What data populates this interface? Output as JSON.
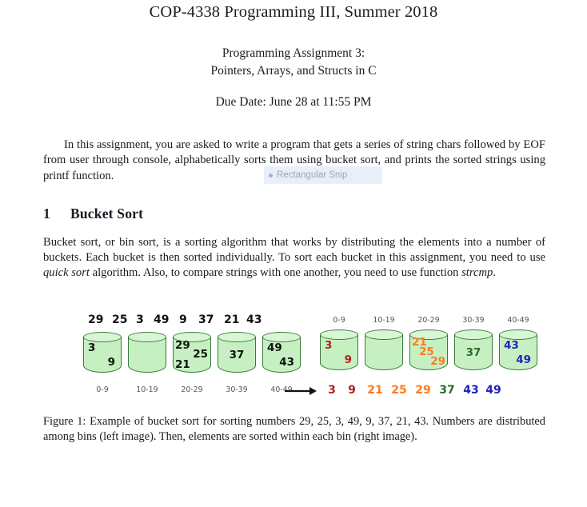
{
  "document": {
    "title": "COP-4338 Programming III, Summer 2018",
    "subtitle_line1": "Programming Assignment 3:",
    "subtitle_line2": "Pointers, Arrays, and Structs in C",
    "due_date": "Due Date: June 28 at 11:55 PM",
    "intro_paragraph": "In this assignment, you are asked to write a program that gets a series of string chars followed by EOF from user through console, alphabetically sorts them using bucket sort, and prints the sorted strings using printf function.",
    "section": {
      "number": "1",
      "heading": "Bucket Sort",
      "paragraph_part1": "Bucket sort, or bin sort, is a sorting algorithm that works by distributing the elements into a number of buckets. Each bucket is then sorted individually. To sort each bucket in this assignment, you need to use ",
      "paragraph_italic1": "quick sort",
      "paragraph_part2": " algorithm. Also, to compare strings with one another, you need to use function ",
      "paragraph_italic2": "strcmp",
      "paragraph_part3": "."
    },
    "caption": "Figure 1: Example of bucket sort for sorting numbers 29, 25, 3, 49, 9, 37, 21, 43. Numbers are distributed among bins (left image). Then, elements are sorted within each bin (right image)."
  },
  "snip_overlay": {
    "label": "Rectangular Snip"
  },
  "figure": {
    "input_sequence": [
      "29",
      "25",
      "3",
      "49",
      "9",
      "37",
      "21",
      "43"
    ],
    "bucket_ranges": [
      "0-9",
      "10-19",
      "20-29",
      "30-39",
      "40-49"
    ],
    "left_buckets": [
      {
        "range": "0-9",
        "items": [
          "3",
          "9"
        ]
      },
      {
        "range": "10-19",
        "items": []
      },
      {
        "range": "20-29",
        "items": [
          "29",
          "25",
          "21"
        ]
      },
      {
        "range": "30-39",
        "items": [
          "37"
        ]
      },
      {
        "range": "40-49",
        "items": [
          "49",
          "43"
        ]
      }
    ],
    "right_buckets": [
      {
        "range": "0-9",
        "items": [
          "3",
          "9"
        ],
        "color": "#b42020"
      },
      {
        "range": "10-19",
        "items": [],
        "color": "#b42020"
      },
      {
        "range": "20-29",
        "items": [
          "21",
          "25",
          "29"
        ],
        "color": "#ff7b20"
      },
      {
        "range": "30-39",
        "items": [
          "37"
        ],
        "color": "#2d6b2d"
      },
      {
        "range": "40-49",
        "items": [
          "43",
          "49"
        ],
        "color": "#2222bb"
      }
    ],
    "sorted_output": [
      {
        "value": "3",
        "color": "#b42020"
      },
      {
        "value": "9",
        "color": "#b42020"
      },
      {
        "value": "21",
        "color": "#ff7b20"
      },
      {
        "value": "25",
        "color": "#ff7b20"
      },
      {
        "value": "29",
        "color": "#ff7b20"
      },
      {
        "value": "37",
        "color": "#2d6b2d"
      },
      {
        "value": "43",
        "color": "#2222bb"
      },
      {
        "value": "49",
        "color": "#2222bb"
      }
    ],
    "bucket_fill_color": "#c6f0c2",
    "bucket_stroke_color": "#3c7a3c",
    "arrow_direction": "right"
  }
}
